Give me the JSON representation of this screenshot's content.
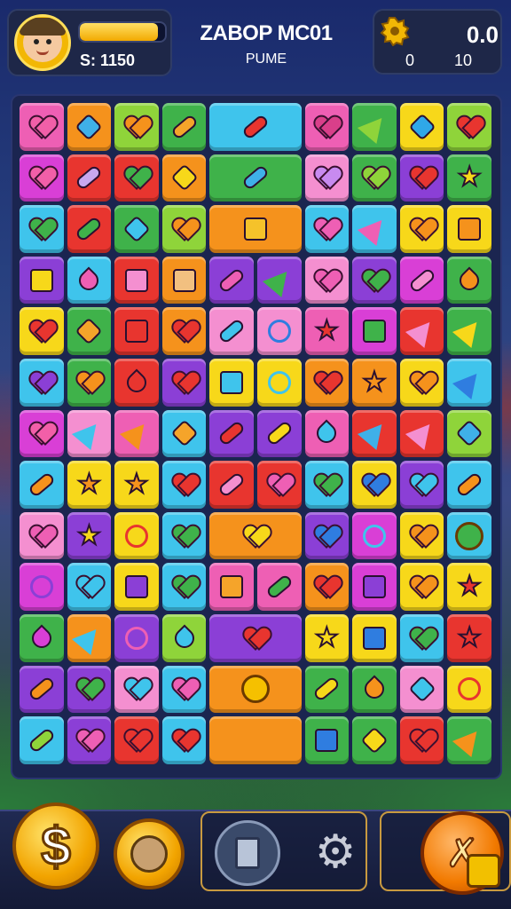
{
  "hud": {
    "player_score": "S: 1150",
    "xp_progress": 0.92,
    "title": "ZABOP MC01",
    "subtitle": "PUME",
    "right_top": "0.0",
    "right_b1": "0",
    "right_b2": "10"
  },
  "colors": {
    "red": "#e8352f",
    "orange": "#f5921c",
    "yellow": "#f7d81a",
    "green": "#3fb24a",
    "lime": "#8fd43a",
    "cyan": "#3fc4ec",
    "blue": "#2f7de0",
    "purple": "#8b3fd6",
    "pink": "#ee5fb4",
    "magenta": "#d93fd6",
    "lightpink": "#f48fd0"
  },
  "board": {
    "rows": [
      [
        [
          "pink",
          "heart",
          "#f25fa8"
        ],
        [
          "orange",
          "gem",
          "#3fb0e8"
        ],
        [
          "lime",
          "heart",
          "#f5921c"
        ],
        [
          "green",
          "pill",
          "#f5a42a"
        ],
        [
          "cyan",
          "pill",
          "#e8352f",
          2
        ],
        [
          "pink",
          "heart",
          "#d93f8a"
        ],
        [
          "green",
          "arrow",
          "#8fd43a"
        ],
        [
          "yellow",
          "gem",
          "#2fa8e8"
        ],
        [
          "lime",
          "heart",
          "#e8352f"
        ]
      ],
      [
        [
          "magenta",
          "heart",
          "#f25fa8"
        ],
        [
          "red",
          "pill",
          "#c8a8f0"
        ],
        [
          "red",
          "heart",
          "#3fb24a"
        ],
        [
          "orange",
          "gem",
          "#f7d81a"
        ],
        [
          "green",
          "pill",
          "#3fb0e8",
          2
        ],
        [
          "lightpink",
          "heart",
          "#c88af0"
        ],
        [
          "green",
          "heart",
          "#8fd43a"
        ],
        [
          "purple",
          "heart",
          "#e8352f"
        ],
        [
          "green",
          "star",
          "#f7d81a"
        ]
      ],
      [
        [
          "cyan",
          "heart",
          "#3fb24a"
        ],
        [
          "red",
          "pill",
          "#3fb24a"
        ],
        [
          "green",
          "gem",
          "#3fc4ec"
        ],
        [
          "lime",
          "heart",
          "#f5921c"
        ],
        [
          "orange",
          "box",
          "#f5c22a",
          2
        ],
        [
          "cyan",
          "heart",
          "#ee5fb4"
        ],
        [
          "cyan",
          "arrow",
          "#ee5fb4"
        ],
        [
          "yellow",
          "heart",
          "#f5921c"
        ],
        [
          "yellow",
          "box",
          "#f5921c"
        ]
      ],
      [
        [
          "purple",
          "box",
          "#f7d81a"
        ],
        [
          "cyan",
          "drop",
          "#ee5fb4"
        ],
        [
          "red",
          "box",
          "#f48fd0"
        ],
        [
          "orange",
          "box",
          "#f2c080"
        ],
        [
          "purple",
          "pill",
          "#ee5fb4"
        ],
        [
          "purple",
          "arrow",
          "#3fb24a"
        ],
        [
          "lightpink",
          "heart",
          "#ee5fb4"
        ],
        [
          "purple",
          "heart",
          "#3fb24a"
        ],
        [
          "magenta",
          "pill",
          "#f48fd0"
        ],
        [
          "green",
          "drop",
          "#f5921c"
        ]
      ],
      [
        [
          "yellow",
          "heart",
          "#e8352f"
        ],
        [
          "green",
          "gem",
          "#f5a42a"
        ],
        [
          "red",
          "box",
          "#e8352f"
        ],
        [
          "orange",
          "heart",
          "#e8352f"
        ],
        [
          "lightpink",
          "pill",
          "#3fc4ec"
        ],
        [
          "lightpink",
          "key",
          "#2f7de0"
        ],
        [
          "pink",
          "star",
          "#e8352f"
        ],
        [
          "magenta",
          "box",
          "#3fb24a"
        ],
        [
          "red",
          "arrow",
          "#f48fd0"
        ],
        [
          "green",
          "arrow",
          "#f7d81a"
        ]
      ],
      [
        [
          "cyan",
          "heart",
          "#8b3fd6"
        ],
        [
          "green",
          "heart",
          "#f5921c"
        ],
        [
          "red",
          "drop",
          "#e8352f"
        ],
        [
          "purple",
          "heart",
          "#e8352f"
        ],
        [
          "yellow",
          "box",
          "#3fc4ec"
        ],
        [
          "yellow",
          "key",
          "#3fc4ec"
        ],
        [
          "orange",
          "heart",
          "#e8352f"
        ],
        [
          "orange",
          "star",
          "#f5921c"
        ],
        [
          "yellow",
          "heart",
          "#f5921c"
        ],
        [
          "cyan",
          "arrow",
          "#2f7de0"
        ]
      ],
      [
        [
          "magenta",
          "heart",
          "#f25fa8"
        ],
        [
          "lightpink",
          "arrow",
          "#3fc4ec"
        ],
        [
          "pink",
          "arrow",
          "#f5921c"
        ],
        [
          "cyan",
          "gem",
          "#f5a42a"
        ],
        [
          "purple",
          "pill",
          "#e8352f"
        ],
        [
          "purple",
          "pill",
          "#f7d81a"
        ],
        [
          "pink",
          "drop",
          "#3fc4ec"
        ],
        [
          "red",
          "arrow",
          "#3fb0e8"
        ],
        [
          "red",
          "arrow",
          "#f48fd0"
        ],
        [
          "lime",
          "gem",
          "#3fb0e8"
        ]
      ],
      [
        [
          "cyan",
          "pill",
          "#f5921c"
        ],
        [
          "yellow",
          "star",
          "#f5921c"
        ],
        [
          "yellow",
          "star",
          "#f5921c"
        ],
        [
          "cyan",
          "heart",
          "#e8352f"
        ],
        [
          "red",
          "pill",
          "#f48fd0"
        ],
        [
          "red",
          "heart",
          "#ee5fb4"
        ],
        [
          "cyan",
          "heart",
          "#3fb24a"
        ],
        [
          "yellow",
          "heart",
          "#2f7de0"
        ],
        [
          "purple",
          "heart",
          "#3fc4ec"
        ],
        [
          "cyan",
          "pill",
          "#f5921c"
        ]
      ],
      [
        [
          "lightpink",
          "heart",
          "#ee5fb4"
        ],
        [
          "purple",
          "star",
          "#f7d81a"
        ],
        [
          "yellow",
          "key",
          "#e8352f"
        ],
        [
          "cyan",
          "heart",
          "#3fb24a"
        ],
        [
          "orange",
          "heart",
          "#f7d81a",
          2
        ],
        [
          "purple",
          "heart",
          "#2f7de0"
        ],
        [
          "magenta",
          "key",
          "#3fc4ec"
        ],
        [
          "yellow",
          "heart",
          "#f5921c"
        ],
        [
          "cyan",
          "circle",
          "#3fb24a"
        ]
      ],
      [
        [
          "magenta",
          "key",
          "#8b3fd6"
        ],
        [
          "cyan",
          "heart",
          "#3fc4ec"
        ],
        [
          "yellow",
          "box",
          "#8b3fd6"
        ],
        [
          "cyan",
          "heart",
          "#3fb24a"
        ],
        [
          "pink",
          "box",
          "#f5a42a"
        ],
        [
          "pink",
          "pill",
          "#3fb24a"
        ],
        [
          "orange",
          "heart",
          "#e8352f"
        ],
        [
          "magenta",
          "box",
          "#8b3fd6"
        ],
        [
          "yellow",
          "heart",
          "#f5921c"
        ],
        [
          "yellow",
          "star",
          "#e8352f"
        ]
      ],
      [
        [
          "green",
          "drop",
          "#d93fd6"
        ],
        [
          "orange",
          "arrow",
          "#3fc4ec"
        ],
        [
          "purple",
          "key",
          "#ee5fb4"
        ],
        [
          "lime",
          "drop",
          "#3fc4ec"
        ],
        [
          "purple",
          "heart",
          "#e8352f",
          2
        ],
        [
          "yellow",
          "star",
          "#f7d81a"
        ],
        [
          "yellow",
          "box",
          "#2f7de0"
        ],
        [
          "cyan",
          "heart",
          "#3fb24a"
        ],
        [
          "red",
          "star",
          "#e8352f"
        ]
      ],
      [
        [
          "purple",
          "pill",
          "#f5921c"
        ],
        [
          "purple",
          "heart",
          "#3fb24a"
        ],
        [
          "lightpink",
          "heart",
          "#3fc4ec"
        ],
        [
          "cyan",
          "heart",
          "#ee5fb4"
        ],
        [
          "orange",
          "circle",
          "#f5c000",
          2
        ],
        [
          "green",
          "pill",
          "#f7d81a"
        ],
        [
          "green",
          "drop",
          "#f5921c"
        ],
        [
          "lightpink",
          "gem",
          "#3fc4ec"
        ],
        [
          "yellow",
          "key",
          "#e8352f"
        ]
      ],
      [
        [
          "cyan",
          "pill",
          "#8fd43a"
        ],
        [
          "purple",
          "heart",
          "#ee5fb4"
        ],
        [
          "red",
          "heart",
          "#e8352f"
        ],
        [
          "cyan",
          "heart",
          "#e8352f"
        ],
        [
          "orange",
          "key",
          "#f5921c",
          2
        ],
        [
          "green",
          "box",
          "#2f7de0"
        ],
        [
          "green",
          "gem",
          "#f7d81a"
        ],
        [
          "red",
          "heart",
          "#e8352f"
        ],
        [
          "green",
          "arrow",
          "#f5921c"
        ]
      ]
    ]
  },
  "bottom_bar": {
    "coin_symbol": "$",
    "shop_symbol": "✗"
  }
}
